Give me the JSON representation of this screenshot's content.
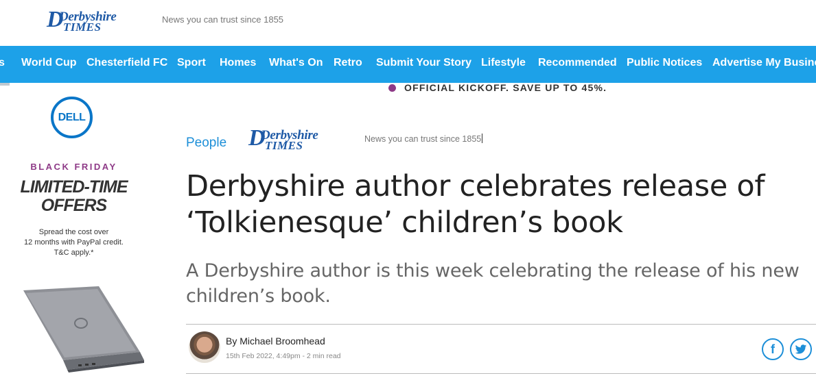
{
  "header": {
    "logo_text_line1": "Derbyshire",
    "logo_text_line2": "TIMES",
    "tagline": "News you can trust since 1855"
  },
  "nav": {
    "items": [
      {
        "label": "s"
      },
      {
        "label": "World Cup"
      },
      {
        "label": "Chesterfield FC"
      },
      {
        "label": "Sport"
      },
      {
        "label": "Homes"
      },
      {
        "label": "What's On"
      },
      {
        "label": "Retro"
      },
      {
        "label": "Submit Your Story"
      },
      {
        "label": "Lifestyle"
      },
      {
        "label": "Recommended"
      },
      {
        "label": "Public Notices"
      },
      {
        "label": "Advertise My Business"
      }
    ]
  },
  "promo": {
    "text": "OFFICIAL KICKOFF. SAVE UP TO 45%."
  },
  "ad": {
    "brand": "DELL",
    "eyebrow": "BLACK FRIDAY",
    "headline_line1": "LIMITED-TIME",
    "headline_line2": "OFFERS",
    "small_line1": "Spread the cost over",
    "small_line2": "12 months with PayPal credit.",
    "small_line3": "T&C apply.*"
  },
  "article": {
    "section": "People",
    "headline": "Derbyshire author celebrates release of ‘Tolkienesque’ children’s book",
    "standfirst": "A Derbyshire author is this week celebrating the release of his new children’s book.",
    "byline": "By Michael Broomhead",
    "meta": "15th Feb 2022, 4:49pm - 2 min read"
  },
  "share": {
    "facebook_glyph": "f",
    "twitter_glyph": "🐦"
  },
  "colors": {
    "nav_bg": "#1da1e8",
    "brand_blue": "#1f5aa6",
    "accent_purple": "#8e3a87",
    "link_blue": "#1d8fd8"
  }
}
